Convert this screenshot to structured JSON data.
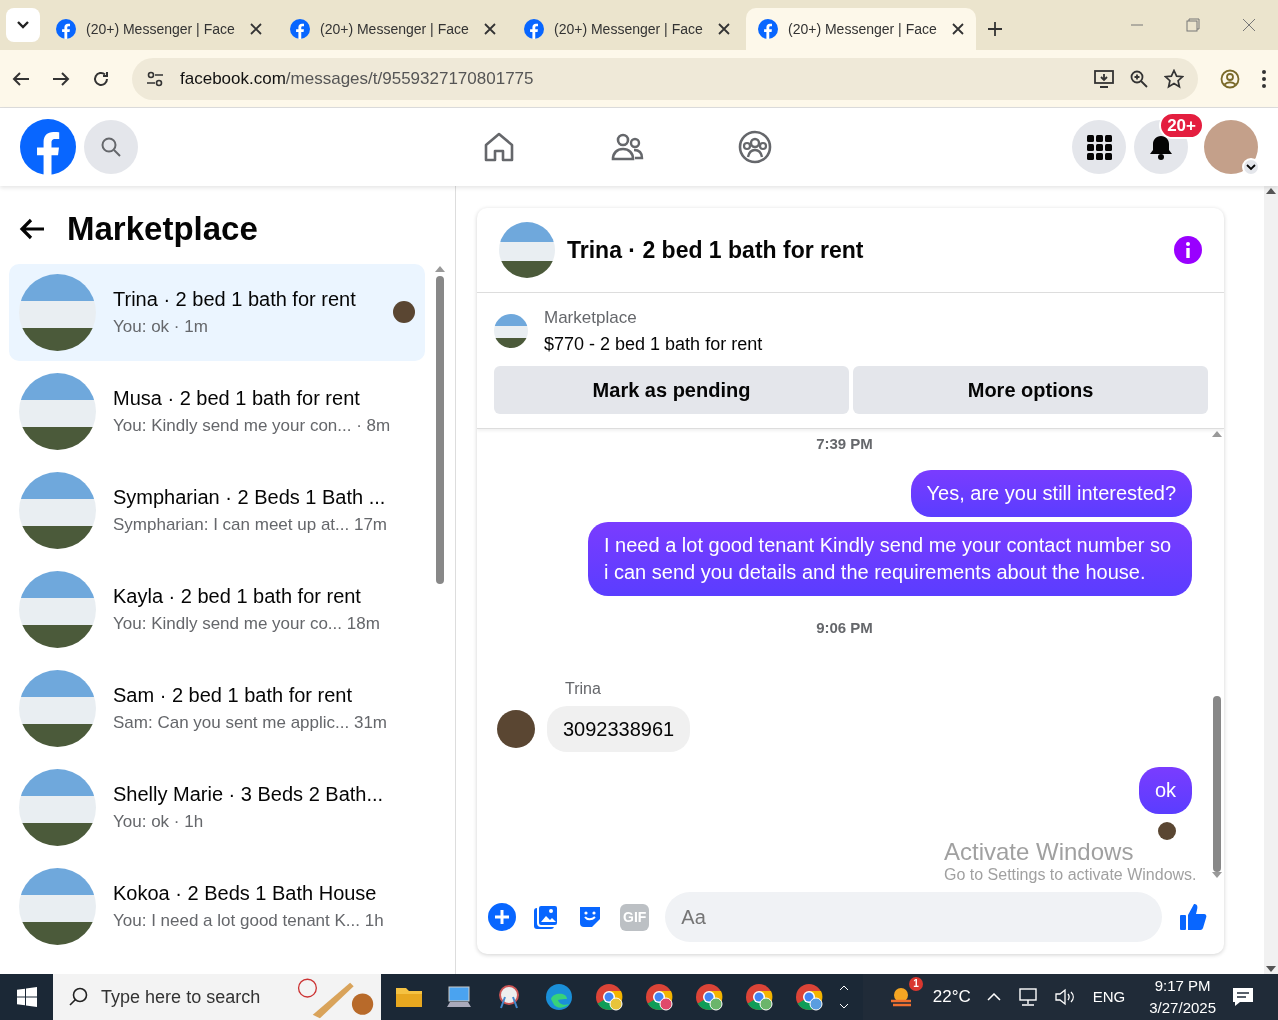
{
  "browser": {
    "tabs": [
      {
        "title": "(20+) Messenger | Face",
        "selected": false
      },
      {
        "title": "(20+) Messenger | Face",
        "selected": false
      },
      {
        "title": "(20+) Messenger | Face",
        "selected": false
      },
      {
        "title": "(20+) Messenger | Face",
        "selected": true
      }
    ],
    "url": {
      "domain": "facebook.com",
      "path": "/messages/t/9559327170801775"
    }
  },
  "top_bar": {
    "notification_badge": "20+"
  },
  "sidebar": {
    "title": "Marketplace",
    "conversations": [
      {
        "title": "Trina · 2 bed 1 bath for rent",
        "subtitle": "You: ok · 1m",
        "selected": true,
        "seen": true
      },
      {
        "title": "Musa · 2 bed 1 bath for rent",
        "subtitle": "You: Kindly send me your con... · 8m",
        "selected": false,
        "seen": false
      },
      {
        "title": "Sympharian · 2 Beds 1 Bath ...",
        "subtitle": "Sympharian: I can meet up at... 17m",
        "selected": false,
        "seen": false
      },
      {
        "title": "Kayla · 2 bed 1 bath for rent",
        "subtitle": "You: Kindly send me your co...   18m",
        "selected": false,
        "seen": false
      },
      {
        "title": "Sam · 2 bed 1 bath for rent",
        "subtitle": "Sam: Can you sent me applic... 31m",
        "selected": false,
        "seen": false
      },
      {
        "title": "Shelly Marie · 3 Beds 2 Bath...",
        "subtitle": "You: ok · 1h",
        "selected": false,
        "seen": false
      },
      {
        "title": "Kokoa · 2 Beds 1 Bath House",
        "subtitle": "You: I need a lot good tenant K... 1h",
        "selected": false,
        "seen": false
      }
    ]
  },
  "chat": {
    "title": "Trina · 2 bed 1 bath for rent",
    "listing": {
      "label": "Marketplace",
      "detail": "$770 - 2 bed 1 bath for rent"
    },
    "buttons": [
      "Mark as pending",
      "More options"
    ],
    "messages": [
      {
        "kind": "timestamp",
        "text": "7:39 PM"
      },
      {
        "kind": "outgoing",
        "text": "Yes, are you still interested?"
      },
      {
        "kind": "outgoing",
        "text": "I need a lot good tenant Kindly send me your contact number so i can send you details and the requirements about the house."
      },
      {
        "kind": "timestamp",
        "text": "9:06 PM"
      },
      {
        "kind": "incoming",
        "sender": "Trina",
        "text": "3092338961"
      },
      {
        "kind": "outgoing",
        "text": "ok",
        "seen": true
      }
    ],
    "composer": {
      "gif_label": "GIF",
      "placeholder": "Aa"
    }
  },
  "windows_notice": {
    "title": "Activate Windows",
    "subtitle": "Go to Settings to activate Windows."
  },
  "taskbar": {
    "search_placeholder": "Type here to search",
    "weather_badge": "1",
    "temperature": "22°C",
    "language": "ENG",
    "time": "9:17 PM",
    "date": "3/27/2025"
  }
}
